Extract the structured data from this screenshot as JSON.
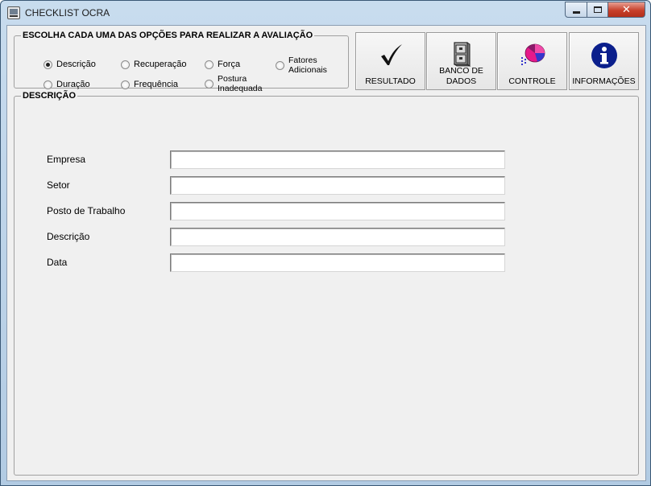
{
  "window": {
    "title": "CHECKLIST OCRA",
    "controls": {
      "minimize": "minimize",
      "maximize": "maximize",
      "close": "✕"
    }
  },
  "options_group": {
    "legend": "ESCOLHA CADA UMA DAS OPÇÕES PARA REALIZAR A AVALIAÇÃO",
    "radios": [
      {
        "label": "Descrição",
        "checked": true
      },
      {
        "label": "Recuperação",
        "checked": false
      },
      {
        "label": "Força",
        "checked": false
      },
      {
        "label": "Fatores\nAdicionais",
        "checked": false
      },
      {
        "label": "Duração",
        "checked": false
      },
      {
        "label": "Frequência",
        "checked": false
      },
      {
        "label": "Postura\nInadequada",
        "checked": false
      }
    ]
  },
  "toolbar": {
    "buttons": [
      {
        "label": "RESULTADO",
        "icon": "checkmark-icon"
      },
      {
        "label": "BANCO DE\nDADOS",
        "icon": "cabinet-icon"
      },
      {
        "label": "CONTROLE",
        "icon": "pie-chart-icon"
      },
      {
        "label": "INFORMAÇÕES",
        "icon": "info-icon"
      }
    ]
  },
  "description_group": {
    "legend": "DESCRIÇÃO",
    "fields": [
      {
        "label": "Empresa",
        "value": ""
      },
      {
        "label": "Setor",
        "value": ""
      },
      {
        "label": "Posto de Trabalho",
        "value": ""
      },
      {
        "label": "Descrição",
        "value": ""
      },
      {
        "label": "Data",
        "value": ""
      }
    ]
  },
  "colors": {
    "close_button": "#c7402b",
    "info_icon": "#0b1f8c",
    "chart_pink": "#e6198a",
    "chart_blue": "#3636cc"
  }
}
